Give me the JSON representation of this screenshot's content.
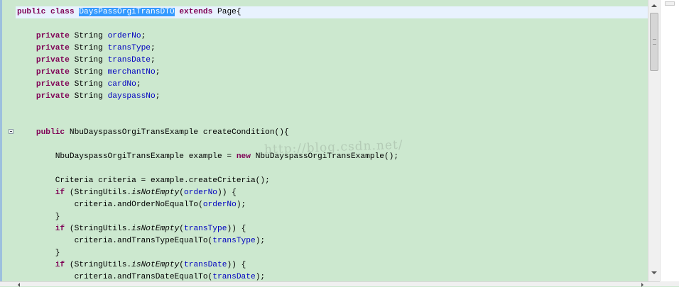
{
  "editor": {
    "colors": {
      "background": "#cce8cf",
      "keyword": "#7f0055",
      "field": "#0000c0",
      "selection": "#3399ff",
      "current_line": "#e8f2fe"
    },
    "watermark": "http://blog.csdn.net/",
    "lines": [
      [
        {
          "t": "public",
          "c": "kw"
        },
        {
          "t": " "
        },
        {
          "t": "class",
          "c": "kw"
        },
        {
          "t": " "
        },
        {
          "t": "DaysPassOrgiTransDTO",
          "c": "sel"
        },
        {
          "t": " "
        },
        {
          "t": "extends",
          "c": "kw"
        },
        {
          "t": " Page{"
        }
      ],
      [],
      [
        {
          "t": "    "
        },
        {
          "t": "private",
          "c": "kw"
        },
        {
          "t": " String "
        },
        {
          "t": "orderNo",
          "c": "fld"
        },
        {
          "t": ";"
        }
      ],
      [
        {
          "t": "    "
        },
        {
          "t": "private",
          "c": "kw"
        },
        {
          "t": " String "
        },
        {
          "t": "transType",
          "c": "fld"
        },
        {
          "t": ";"
        }
      ],
      [
        {
          "t": "    "
        },
        {
          "t": "private",
          "c": "kw"
        },
        {
          "t": " String "
        },
        {
          "t": "transDate",
          "c": "fld"
        },
        {
          "t": ";"
        }
      ],
      [
        {
          "t": "    "
        },
        {
          "t": "private",
          "c": "kw"
        },
        {
          "t": " String "
        },
        {
          "t": "merchantNo",
          "c": "fld"
        },
        {
          "t": ";"
        }
      ],
      [
        {
          "t": "    "
        },
        {
          "t": "private",
          "c": "kw"
        },
        {
          "t": " String "
        },
        {
          "t": "cardNo",
          "c": "fld"
        },
        {
          "t": ";"
        }
      ],
      [
        {
          "t": "    "
        },
        {
          "t": "private",
          "c": "kw"
        },
        {
          "t": " String "
        },
        {
          "t": "dayspassNo",
          "c": "fld"
        },
        {
          "t": ";"
        }
      ],
      [],
      [],
      [
        {
          "t": "    "
        },
        {
          "t": "public",
          "c": "kw"
        },
        {
          "t": " NbuDayspassOrgiTransExample createCondition(){"
        }
      ],
      [],
      [
        {
          "t": "        NbuDayspassOrgiTransExample example = "
        },
        {
          "t": "new",
          "c": "kw"
        },
        {
          "t": " NbuDayspassOrgiTransExample();"
        }
      ],
      [],
      [
        {
          "t": "        Criteria criteria = example.createCriteria();"
        }
      ],
      [
        {
          "t": "        "
        },
        {
          "t": "if",
          "c": "kw"
        },
        {
          "t": " (StringUtils."
        },
        {
          "t": "isNotEmpty",
          "c": "itl"
        },
        {
          "t": "("
        },
        {
          "t": "orderNo",
          "c": "fld"
        },
        {
          "t": ")) {"
        }
      ],
      [
        {
          "t": "            criteria.andOrderNoEqualTo("
        },
        {
          "t": "orderNo",
          "c": "fld"
        },
        {
          "t": ");"
        }
      ],
      [
        {
          "t": "        }"
        }
      ],
      [
        {
          "t": "        "
        },
        {
          "t": "if",
          "c": "kw"
        },
        {
          "t": " (StringUtils."
        },
        {
          "t": "isNotEmpty",
          "c": "itl"
        },
        {
          "t": "("
        },
        {
          "t": "transType",
          "c": "fld"
        },
        {
          "t": ")) {"
        }
      ],
      [
        {
          "t": "            criteria.andTransTypeEqualTo("
        },
        {
          "t": "transType",
          "c": "fld"
        },
        {
          "t": ");"
        }
      ],
      [
        {
          "t": "        }"
        }
      ],
      [
        {
          "t": "        "
        },
        {
          "t": "if",
          "c": "kw"
        },
        {
          "t": " (StringUtils."
        },
        {
          "t": "isNotEmpty",
          "c": "itl"
        },
        {
          "t": "("
        },
        {
          "t": "transDate",
          "c": "fld"
        },
        {
          "t": ")) {"
        }
      ],
      [
        {
          "t": "            criteria.andTransDateEqualTo("
        },
        {
          "t": "transDate",
          "c": "fld"
        },
        {
          "t": ");"
        }
      ]
    ]
  }
}
